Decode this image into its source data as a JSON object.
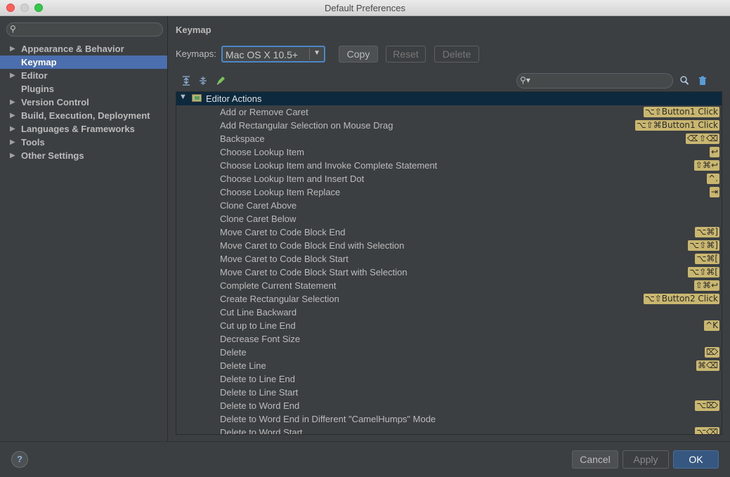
{
  "window": {
    "title": "Default Preferences"
  },
  "sidebar": {
    "search_placeholder": "",
    "items": [
      {
        "label": "Appearance & Behavior",
        "has_arrow": true,
        "selected": false
      },
      {
        "label": "Keymap",
        "has_arrow": false,
        "selected": true
      },
      {
        "label": "Editor",
        "has_arrow": true,
        "selected": false
      },
      {
        "label": "Plugins",
        "has_arrow": false,
        "selected": false
      },
      {
        "label": "Version Control",
        "has_arrow": true,
        "selected": false
      },
      {
        "label": "Build, Execution, Deployment",
        "has_arrow": true,
        "selected": false
      },
      {
        "label": "Languages & Frameworks",
        "has_arrow": true,
        "selected": false
      },
      {
        "label": "Tools",
        "has_arrow": true,
        "selected": false
      },
      {
        "label": "Other Settings",
        "has_arrow": true,
        "selected": false
      }
    ]
  },
  "keymap": {
    "section_title": "Keymap",
    "label": "Keymaps:",
    "selected": "Mac OS X 10.5+",
    "buttons": {
      "copy": "Copy",
      "reset": "Reset",
      "delete": "Delete"
    },
    "group": "Editor Actions",
    "actions": [
      {
        "name": "Add or Remove Caret",
        "keys": [
          "⌥⇧Button1 Click"
        ]
      },
      {
        "name": "Add Rectangular Selection on Mouse Drag",
        "keys": [
          "⌥⇧⌘Button1 Click"
        ]
      },
      {
        "name": "Backspace",
        "keys": [
          "⌫",
          "⇧⌫"
        ]
      },
      {
        "name": "Choose Lookup Item",
        "keys": [
          "↩"
        ]
      },
      {
        "name": "Choose Lookup Item and Invoke Complete Statement",
        "keys": [
          "⇧⌘↩"
        ]
      },
      {
        "name": "Choose Lookup Item and Insert Dot",
        "keys": [
          "^."
        ]
      },
      {
        "name": "Choose Lookup Item Replace",
        "keys": [
          "⇥"
        ]
      },
      {
        "name": "Clone Caret Above",
        "keys": []
      },
      {
        "name": "Clone Caret Below",
        "keys": []
      },
      {
        "name": "Move Caret to Code Block End",
        "keys": [
          "⌥⌘]"
        ]
      },
      {
        "name": "Move Caret to Code Block End with Selection",
        "keys": [
          "⌥⇧⌘]"
        ]
      },
      {
        "name": "Move Caret to Code Block Start",
        "keys": [
          "⌥⌘["
        ]
      },
      {
        "name": "Move Caret to Code Block Start with Selection",
        "keys": [
          "⌥⇧⌘["
        ]
      },
      {
        "name": "Complete Current Statement",
        "keys": [
          "⇧⌘↩"
        ]
      },
      {
        "name": "Create Rectangular Selection",
        "keys": [
          "⌥⇧Button2 Click"
        ]
      },
      {
        "name": "Cut Line Backward",
        "keys": []
      },
      {
        "name": "Cut up to Line End",
        "keys": [
          "^K"
        ]
      },
      {
        "name": "Decrease Font Size",
        "keys": []
      },
      {
        "name": "Delete",
        "keys": [
          "⌦"
        ]
      },
      {
        "name": "Delete Line",
        "keys": [
          "⌘⌫"
        ]
      },
      {
        "name": "Delete to Line End",
        "keys": []
      },
      {
        "name": "Delete to Line Start",
        "keys": []
      },
      {
        "name": "Delete to Word End",
        "keys": [
          "⌥⌦"
        ]
      },
      {
        "name": "Delete to Word End in Different \"CamelHumps\" Mode",
        "keys": []
      },
      {
        "name": "Delete to Word Start",
        "keys": [
          "⌥⌫"
        ]
      }
    ]
  },
  "footer": {
    "help": "?",
    "cancel": "Cancel",
    "apply": "Apply",
    "ok": "OK"
  },
  "colors": {
    "accent": "#4b6eaf",
    "shortcut_badge": "#c9b66f",
    "group_row": "#0d293e",
    "ok_button": "#365880"
  }
}
